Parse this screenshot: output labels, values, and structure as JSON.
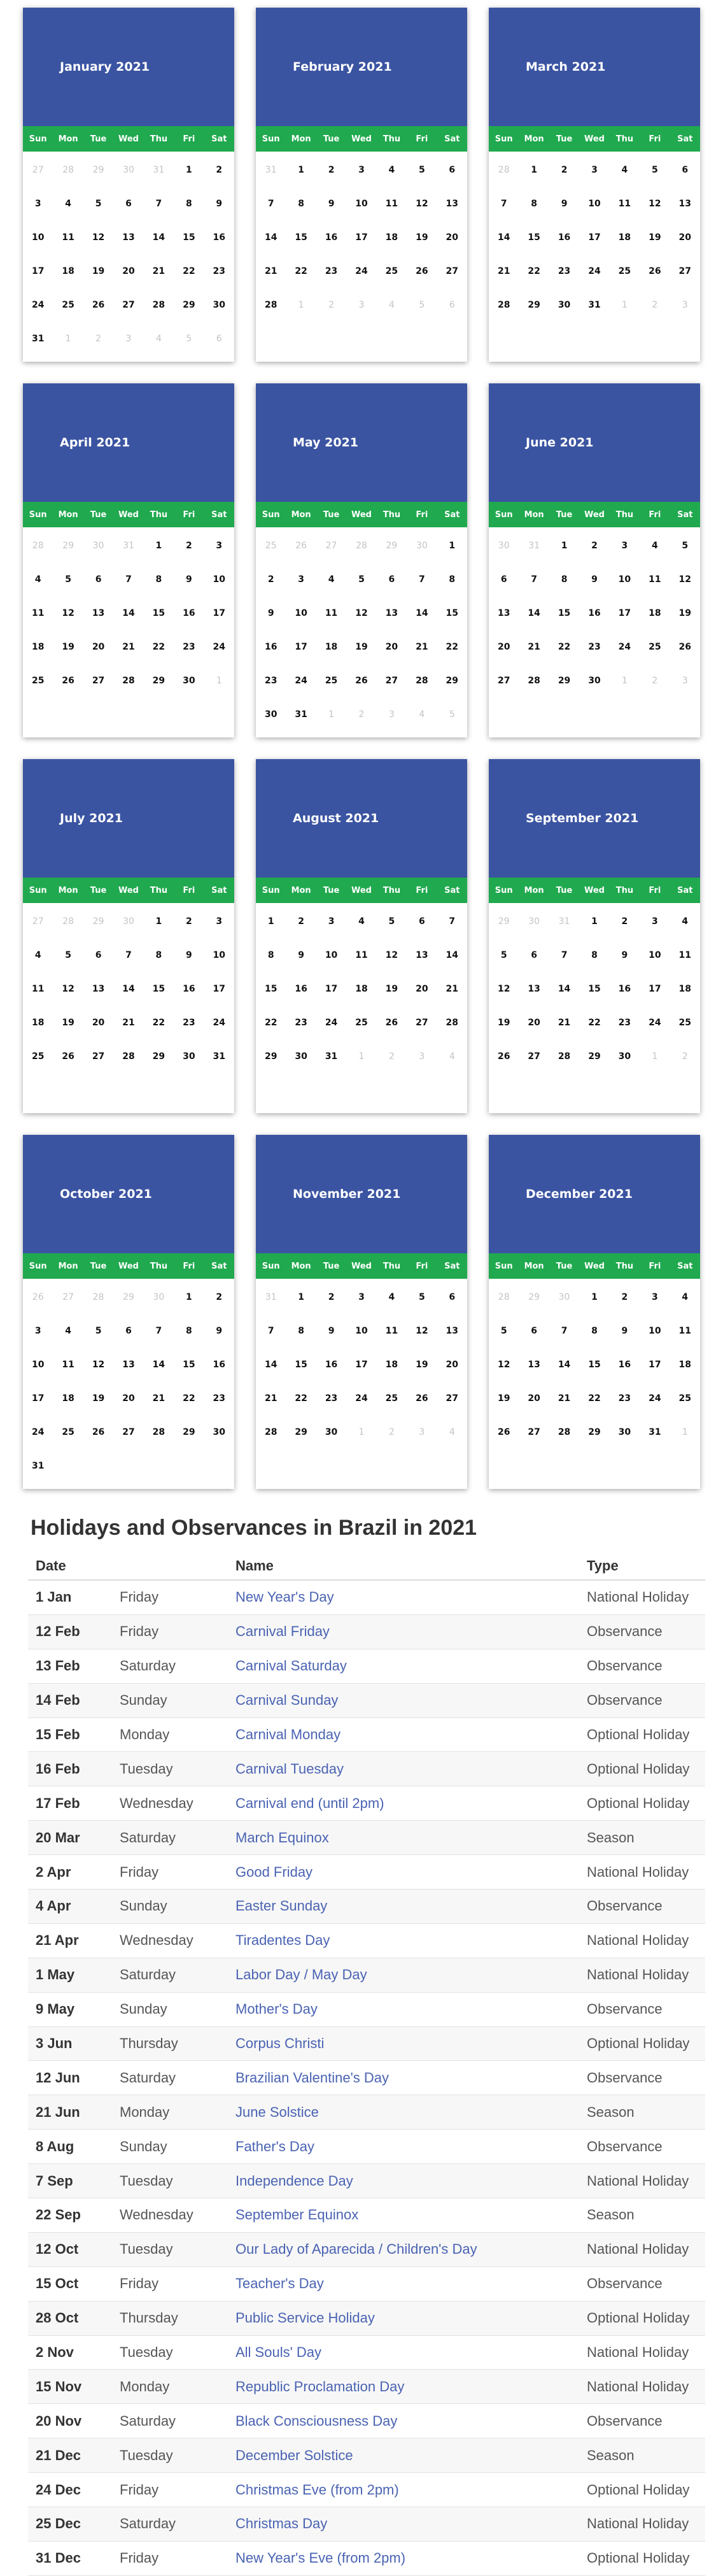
{
  "weekdays": [
    "Sun",
    "Mon",
    "Tue",
    "Wed",
    "Thu",
    "Fri",
    "Sat"
  ],
  "months": [
    {
      "title": "January 2021",
      "lead": [
        27,
        28,
        29,
        30,
        31
      ],
      "days": 31,
      "trail": [
        1,
        2,
        3,
        4,
        5,
        6
      ]
    },
    {
      "title": "February 2021",
      "lead": [
        31
      ],
      "days": 28,
      "trail": [
        1,
        2,
        3,
        4,
        5,
        6
      ]
    },
    {
      "title": "March 2021",
      "lead": [
        28
      ],
      "days": 31,
      "trail": [
        1,
        2,
        3
      ]
    },
    {
      "title": "April 2021",
      "lead": [
        28,
        29,
        30,
        31
      ],
      "days": 30,
      "trail": [
        1
      ]
    },
    {
      "title": "May 2021",
      "lead": [
        25,
        26,
        27,
        28,
        29,
        30
      ],
      "days": 31,
      "trail": [
        1,
        2,
        3,
        4,
        5
      ]
    },
    {
      "title": "June 2021",
      "lead": [
        30,
        31
      ],
      "days": 30,
      "trail": [
        1,
        2,
        3
      ]
    },
    {
      "title": "July 2021",
      "lead": [
        27,
        28,
        29,
        30
      ],
      "days": 31,
      "trail": []
    },
    {
      "title": "August 2021",
      "lead": [],
      "days": 31,
      "trail": [
        1,
        2,
        3,
        4
      ]
    },
    {
      "title": "September 2021",
      "lead": [
        29,
        30,
        31
      ],
      "days": 30,
      "trail": [
        1,
        2
      ]
    },
    {
      "title": "October 2021",
      "lead": [
        26,
        27,
        28,
        29,
        30
      ],
      "days": 31,
      "trail": []
    },
    {
      "title": "November 2021",
      "lead": [
        31
      ],
      "days": 30,
      "trail": [
        1,
        2,
        3,
        4
      ]
    },
    {
      "title": "December 2021",
      "lead": [
        28,
        29,
        30
      ],
      "days": 31,
      "trail": [
        1
      ]
    }
  ],
  "holidays": {
    "title": "Holidays and Observances in Brazil in 2021",
    "headers": {
      "date": "Date",
      "weekday": "",
      "name": "Name",
      "type": "Type"
    },
    "rows": [
      {
        "date": "1 Jan",
        "day": "Friday",
        "name": "New Year's Day",
        "type": "National Holiday"
      },
      {
        "date": "12 Feb",
        "day": "Friday",
        "name": "Carnival Friday",
        "type": "Observance"
      },
      {
        "date": "13 Feb",
        "day": "Saturday",
        "name": "Carnival Saturday",
        "type": "Observance"
      },
      {
        "date": "14 Feb",
        "day": "Sunday",
        "name": "Carnival Sunday",
        "type": "Observance"
      },
      {
        "date": "15 Feb",
        "day": "Monday",
        "name": "Carnival Monday",
        "type": "Optional Holiday"
      },
      {
        "date": "16 Feb",
        "day": "Tuesday",
        "name": "Carnival Tuesday",
        "type": "Optional Holiday"
      },
      {
        "date": "17 Feb",
        "day": "Wednesday",
        "name": "Carnival end (until 2pm)",
        "type": "Optional Holiday"
      },
      {
        "date": "20 Mar",
        "day": "Saturday",
        "name": "March Equinox",
        "type": "Season"
      },
      {
        "date": "2 Apr",
        "day": "Friday",
        "name": "Good Friday",
        "type": "National Holiday"
      },
      {
        "date": "4 Apr",
        "day": "Sunday",
        "name": "Easter Sunday",
        "type": "Observance"
      },
      {
        "date": "21 Apr",
        "day": "Wednesday",
        "name": "Tiradentes Day",
        "type": "National Holiday"
      },
      {
        "date": "1 May",
        "day": "Saturday",
        "name": "Labor Day / May Day",
        "type": "National Holiday"
      },
      {
        "date": "9 May",
        "day": "Sunday",
        "name": "Mother's Day",
        "type": "Observance"
      },
      {
        "date": "3 Jun",
        "day": "Thursday",
        "name": "Corpus Christi",
        "type": "Optional Holiday"
      },
      {
        "date": "12 Jun",
        "day": "Saturday",
        "name": "Brazilian Valentine's Day",
        "type": "Observance"
      },
      {
        "date": "21 Jun",
        "day": "Monday",
        "name": "June Solstice",
        "type": "Season"
      },
      {
        "date": "8 Aug",
        "day": "Sunday",
        "name": "Father's Day",
        "type": "Observance"
      },
      {
        "date": "7 Sep",
        "day": "Tuesday",
        "name": "Independence Day",
        "type": "National Holiday"
      },
      {
        "date": "22 Sep",
        "day": "Wednesday",
        "name": "September Equinox",
        "type": "Season"
      },
      {
        "date": "12 Oct",
        "day": "Tuesday",
        "name": "Our Lady of Aparecida / Children's Day",
        "type": "National Holiday"
      },
      {
        "date": "15 Oct",
        "day": "Friday",
        "name": "Teacher's Day",
        "type": "Observance"
      },
      {
        "date": "28 Oct",
        "day": "Thursday",
        "name": "Public Service Holiday",
        "type": "Optional Holiday"
      },
      {
        "date": "2 Nov",
        "day": "Tuesday",
        "name": "All Souls' Day",
        "type": "National Holiday"
      },
      {
        "date": "15 Nov",
        "day": "Monday",
        "name": "Republic Proclamation Day",
        "type": "National Holiday"
      },
      {
        "date": "20 Nov",
        "day": "Saturday",
        "name": "Black Consciousness Day",
        "type": "Observance"
      },
      {
        "date": "21 Dec",
        "day": "Tuesday",
        "name": "December Solstice",
        "type": "Season"
      },
      {
        "date": "24 Dec",
        "day": "Friday",
        "name": "Christmas Eve (from 2pm)",
        "type": "Optional Holiday"
      },
      {
        "date": "25 Dec",
        "day": "Saturday",
        "name": "Christmas Day",
        "type": "National Holiday"
      },
      {
        "date": "31 Dec",
        "day": "Friday",
        "name": "New Year's Eve (from 2pm)",
        "type": "Optional Holiday"
      }
    ]
  }
}
